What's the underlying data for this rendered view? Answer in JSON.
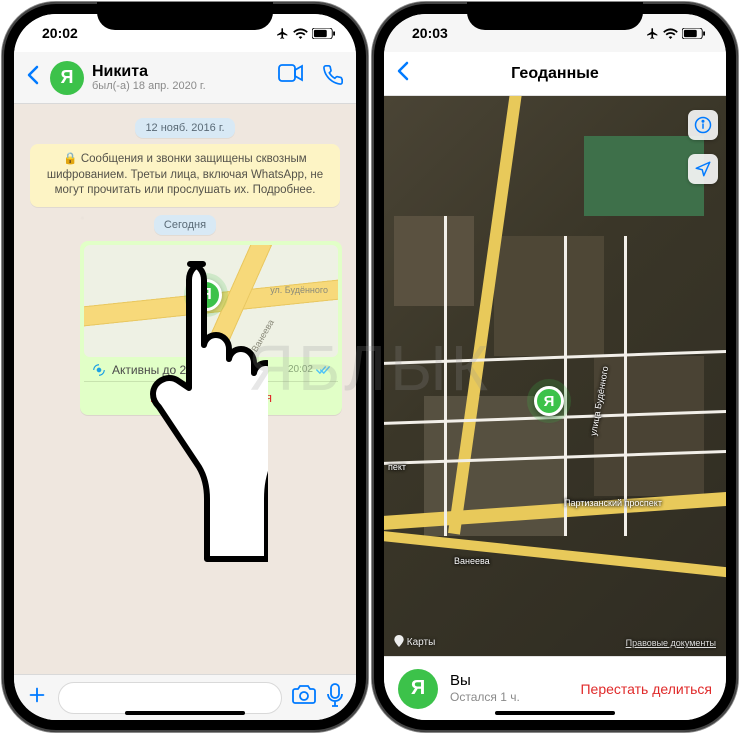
{
  "left": {
    "status": {
      "time": "20:02"
    },
    "header": {
      "avatar_letter": "Я",
      "name": "Никита",
      "last_seen": "был(-а) 18 апр. 2020 г."
    },
    "chat": {
      "date_pill": "12 нояб. 2016 г.",
      "encryption_notice": "🔒 Сообщения и звонки защищены сквозным шифрованием. Третьи лица, включая WhatsApp, не могут прочитать или прослушать их. Подробнее.",
      "today_pill": "Сегодня",
      "location": {
        "street1": "ул. Будённого",
        "street2": "ул. Ванеева",
        "pin_letter": "Я",
        "active_until": "Активны до 21:02",
        "timestamp": "20:02",
        "stop_label": "Перестать делиться"
      }
    }
  },
  "right": {
    "status": {
      "time": "20:03"
    },
    "title": "Геоданные",
    "map": {
      "pin_letter": "Я",
      "streets": {
        "budennogo": "улица Будённого",
        "partizansky": "Партизанский проспект",
        "vaneeva": "Ванеева",
        "pekt": "пект"
      },
      "credit": "Карты",
      "legal": "Правовые документы"
    },
    "footer": {
      "avatar_letter": "Я",
      "you_label": "Вы",
      "remaining": "Остался 1 ч.",
      "stop_label": "Перестать делиться"
    }
  },
  "watermark": "ЯБЛЫК"
}
